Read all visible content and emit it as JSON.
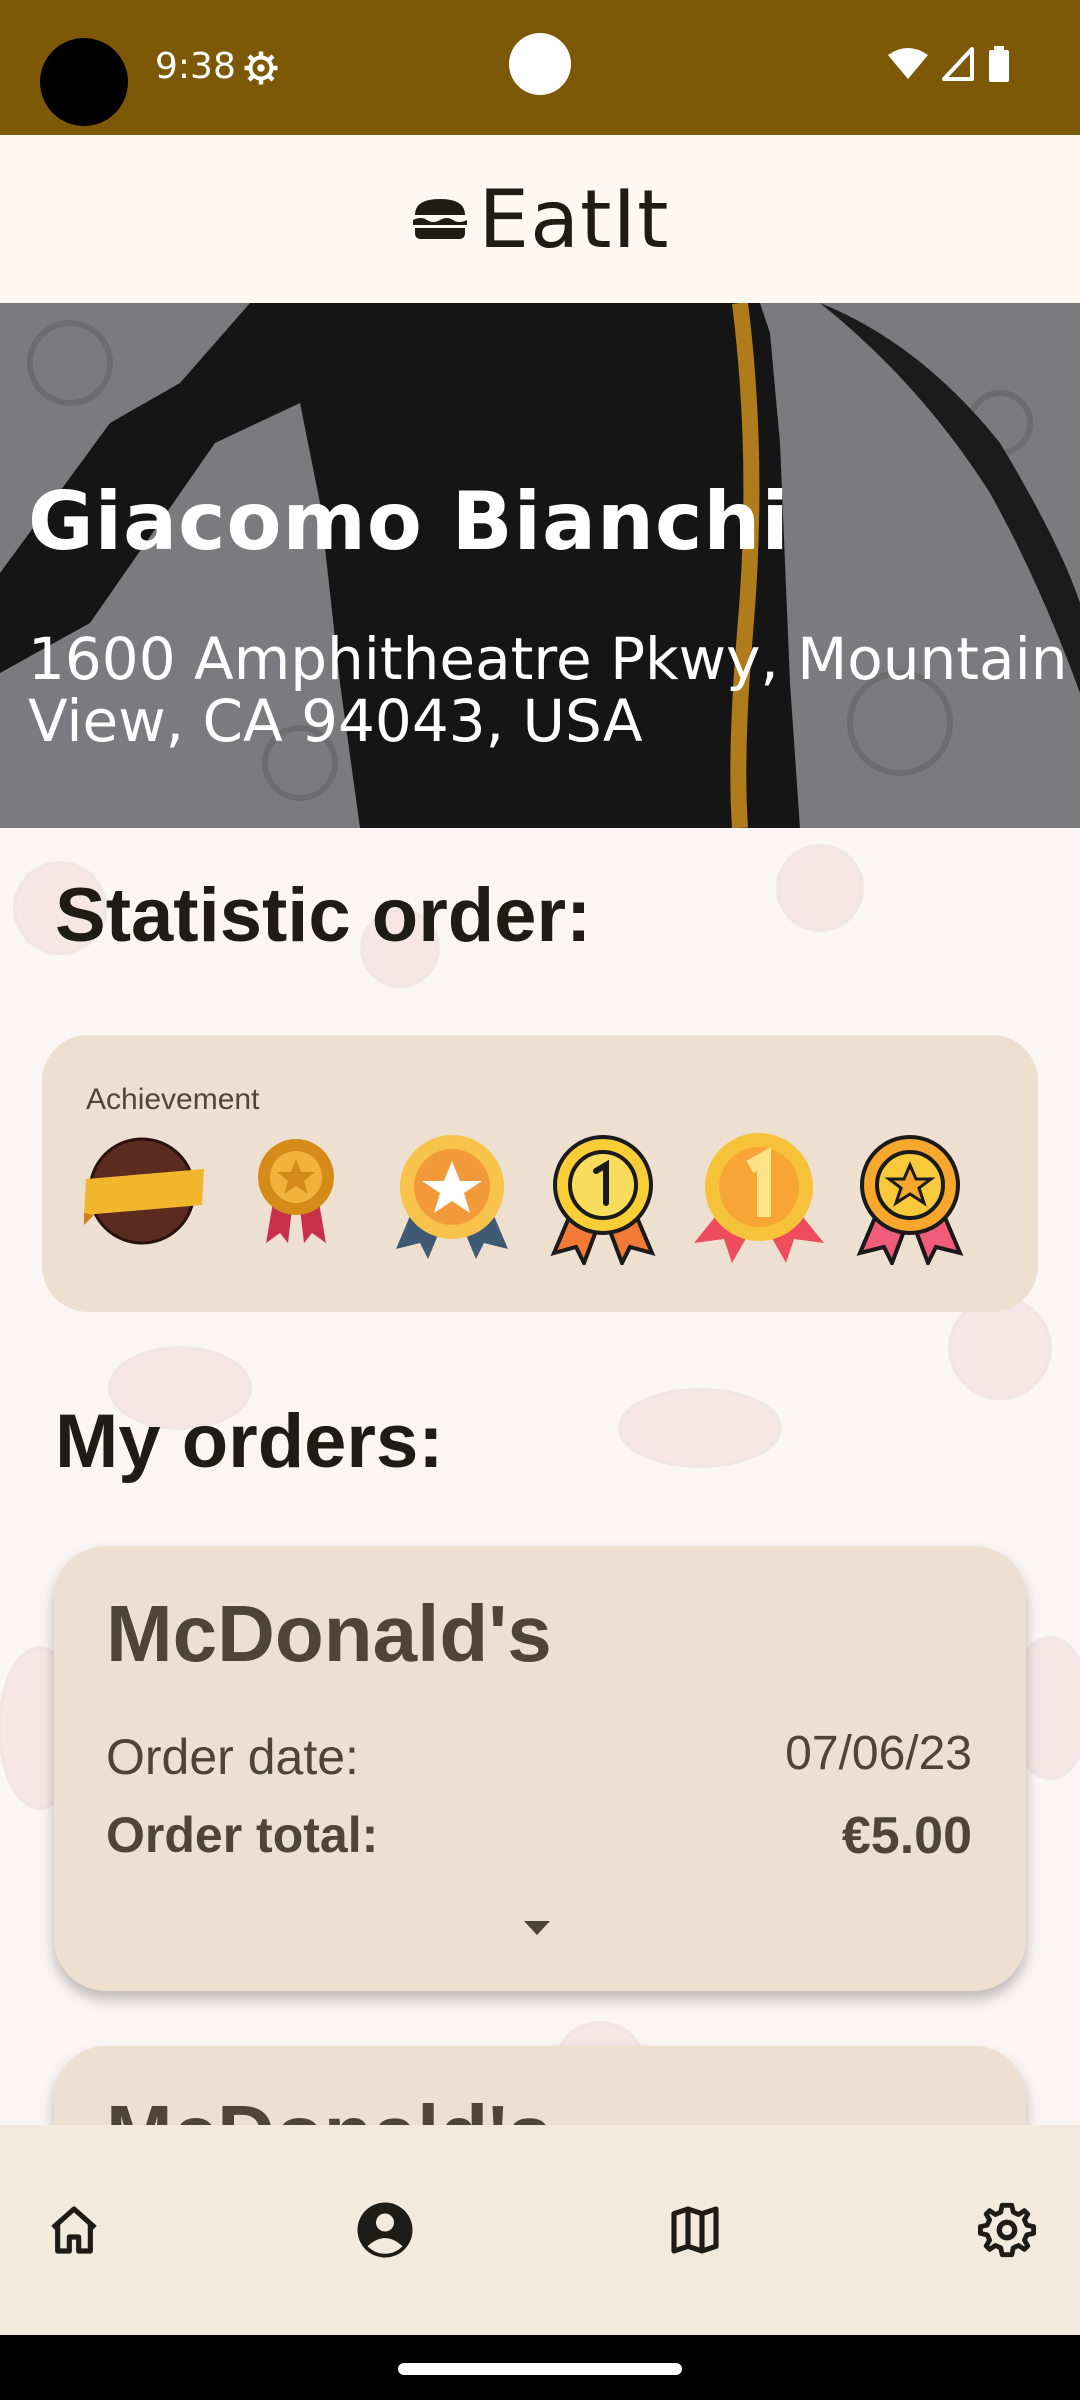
{
  "status_bar": {
    "time": "9:38"
  },
  "app": {
    "title": "EatIt",
    "logo_icon": "burger-icon"
  },
  "profile": {
    "name": "Giacomo Bianchi",
    "address": "1600 Amphitheatre Pkwy, Mountain View, CA 94043, USA"
  },
  "statistics": {
    "title": "Statistic order:",
    "achievement_label": "Achievement",
    "badges": [
      "brown-ribbon-badge",
      "gold-rosette-badge",
      "star-medal-badge",
      "number-one-medal-badge",
      "gold-number-one-medal-badge",
      "star-ribbon-medal-badge"
    ]
  },
  "orders": {
    "title": "My orders:",
    "items": [
      {
        "restaurant": "McDonald's",
        "date_label": "Order date:",
        "date": "07/06/23",
        "total_label": "Order total:",
        "total": "€5.00"
      },
      {
        "restaurant": "McDonald's"
      }
    ]
  },
  "bottom_nav": {
    "items": [
      "home-icon",
      "account-icon",
      "map-icon",
      "settings-icon"
    ],
    "selected": "account-icon"
  },
  "colors": {
    "status_bar": "#7d5806",
    "app_bar": "#fdf8f2",
    "card": "#ede0d0",
    "nav": "#f3eadd",
    "text_dark": "#4e4437"
  }
}
